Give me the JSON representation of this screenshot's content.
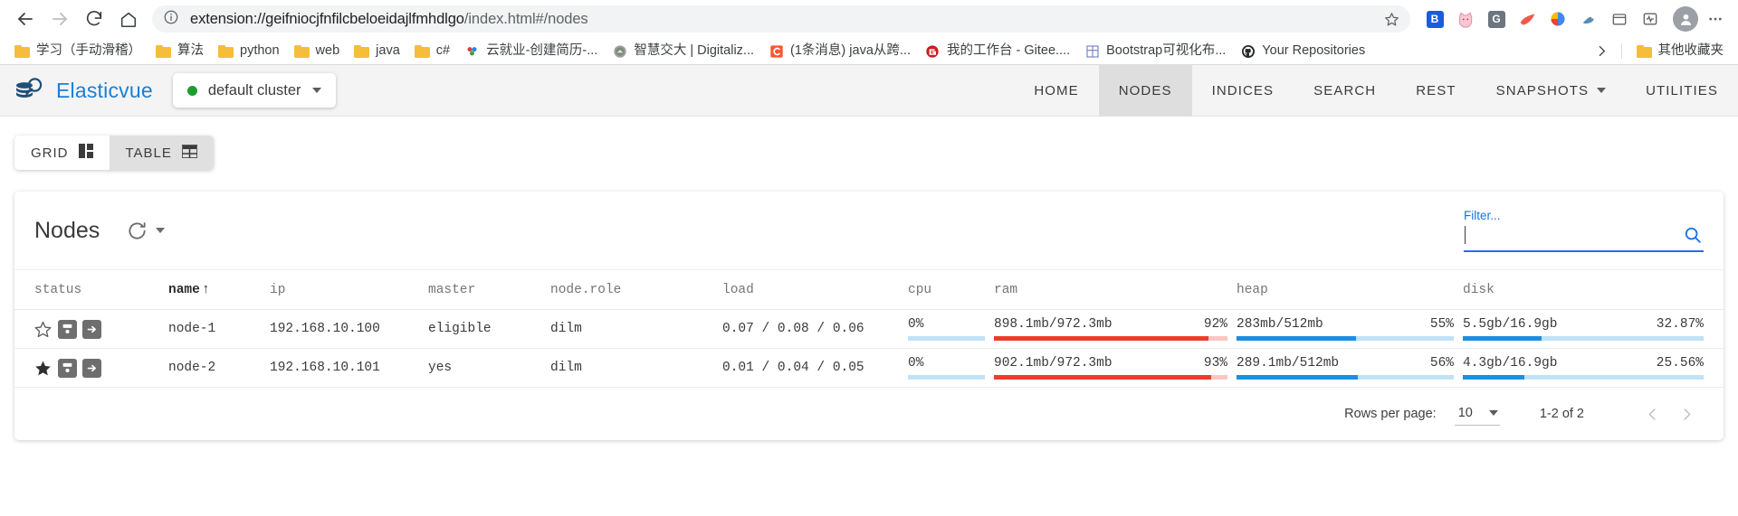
{
  "browser": {
    "back_icon": "back-arrow-icon",
    "forward_icon": "forward-arrow-icon",
    "reload_icon": "reload-icon",
    "home_icon": "home-icon",
    "url_prefix": "extension://geifniocjfnfilcbeloeidajlfmhdlgo",
    "url_suffix": "/index.html#/nodes",
    "url_full": "extension://geifniocjfnfilcbeloeidajlfmhdlgo/index.html#/nodes",
    "bookmark_star_icon": "star-outline-icon",
    "profile_icon": "profile-avatar-icon",
    "menu_icon": "three-dots-menu-icon",
    "extensions": [
      {
        "name": "extension-bitwarden",
        "glyph": "B",
        "color": "#175ddc"
      },
      {
        "name": "extension-pink-cat",
        "glyph": "",
        "color": "#f8bbd0"
      },
      {
        "name": "extension-grammarly",
        "glyph": "G",
        "color": "#15c39a"
      },
      {
        "name": "extension-orange-swoosh",
        "glyph": "",
        "color": "#f25c54"
      },
      {
        "name": "extension-colorful-globe",
        "glyph": "",
        "color": "#4285f4"
      },
      {
        "name": "extension-blue-bird",
        "glyph": "",
        "color": "#4a7fb5"
      },
      {
        "name": "extension-collections",
        "glyph": "",
        "color": "#5f6368"
      },
      {
        "name": "extension-browser-essentials",
        "glyph": "",
        "color": "#5f6368"
      }
    ],
    "bookmarks": [
      {
        "label": "学习（手动滑稽）",
        "icon": "folder-icon",
        "type": "folder"
      },
      {
        "label": "算法",
        "icon": "folder-icon",
        "type": "folder"
      },
      {
        "label": "python",
        "icon": "folder-icon",
        "type": "folder"
      },
      {
        "label": "web",
        "icon": "folder-icon",
        "type": "folder"
      },
      {
        "label": "java",
        "icon": "folder-icon",
        "type": "folder"
      },
      {
        "label": "c#",
        "icon": "folder-icon",
        "type": "folder"
      },
      {
        "label": "云就业-创建简历-...",
        "icon": "dots-colorful-icon",
        "type": "link"
      },
      {
        "label": "智慧交大 | Digitaliz...",
        "icon": "jiaoda-seal-icon",
        "type": "link"
      },
      {
        "label": "(1条消息) java从跨...",
        "icon": "csdn-icon",
        "type": "link"
      },
      {
        "label": "我的工作台 - Gitee....",
        "icon": "gitee-icon",
        "type": "link"
      },
      {
        "label": "Bootstrap可视化布...",
        "icon": "bootstrap-grid-icon",
        "type": "link"
      },
      {
        "label": "Your Repositories",
        "icon": "github-icon",
        "type": "link"
      }
    ],
    "bookmarks_overflow_icon": "chevron-right-icon",
    "other_bookmarks": {
      "label": "其他收藏夹",
      "icon": "folder-icon"
    }
  },
  "app": {
    "brand": "Elasticvue",
    "logo_icon": "elasticvue-logo-icon",
    "cluster": {
      "name": "default cluster",
      "status_color": "#1f9c31",
      "status_icon": "green-dot-icon",
      "caret_icon": "caret-down-icon"
    },
    "nav": [
      {
        "label": "HOME",
        "name": "nav-home",
        "active": false,
        "caret": false
      },
      {
        "label": "NODES",
        "name": "nav-nodes",
        "active": true,
        "caret": false
      },
      {
        "label": "INDICES",
        "name": "nav-indices",
        "active": false,
        "caret": false
      },
      {
        "label": "SEARCH",
        "name": "nav-search",
        "active": false,
        "caret": false
      },
      {
        "label": "REST",
        "name": "nav-rest",
        "active": false,
        "caret": false
      },
      {
        "label": "SNAPSHOTS",
        "name": "nav-snapshots",
        "active": false,
        "caret": true
      },
      {
        "label": "UTILITIES",
        "name": "nav-utilities",
        "active": false,
        "caret": false
      }
    ],
    "view_toggle": [
      {
        "label": "GRID",
        "icon": "grid-view-icon",
        "active": false
      },
      {
        "label": "TABLE",
        "icon": "table-view-icon",
        "active": true
      }
    ],
    "card": {
      "title": "Nodes",
      "refresh_icon": "refresh-icon",
      "refresh_caret_icon": "caret-down-icon",
      "filter": {
        "label": "Filter...",
        "value": "",
        "placeholder": "",
        "search_icon": "magnifier-icon",
        "accent": "#1a73e8"
      }
    },
    "table": {
      "columns": [
        {
          "key": "status",
          "label": "status",
          "sorted": false
        },
        {
          "key": "name",
          "label": "name",
          "sorted": true,
          "sort_icon": "↑"
        },
        {
          "key": "ip",
          "label": "ip",
          "sorted": false
        },
        {
          "key": "master",
          "label": "master",
          "sorted": false
        },
        {
          "key": "node_role",
          "label": "node.role",
          "sorted": false
        },
        {
          "key": "load",
          "label": "load",
          "sorted": false
        },
        {
          "key": "cpu",
          "label": "cpu",
          "sorted": false
        },
        {
          "key": "ram",
          "label": "ram",
          "sorted": false
        },
        {
          "key": "heap",
          "label": "heap",
          "sorted": false
        },
        {
          "key": "disk",
          "label": "disk",
          "sorted": false
        }
      ],
      "rows": [
        {
          "star_icon": "star-outline-icon",
          "star_filled": false,
          "action_icons": [
            "database-icon",
            "arrow-right-box-icon"
          ],
          "name": "node-1",
          "ip": "192.168.10.100",
          "master": "eligible",
          "node_role": "dilm",
          "load": "0.07 / 0.08 / 0.06",
          "cpu_pct_text": "0%",
          "cpu_pct": 0,
          "cpu_color": "#1a8fe3",
          "cpu_track": "#bfe2f7",
          "ram_text": "898.1mb/972.3mb",
          "ram_pct_text": "92%",
          "ram_pct": 92,
          "ram_color": "#ef3b2c",
          "ram_track": "#fbc6c1",
          "heap_text": "283mb/512mb",
          "heap_pct_text": "55%",
          "heap_pct": 55,
          "heap_color": "#1a8fe3",
          "heap_track": "#bfe2f7",
          "disk_text": "5.5gb/16.9gb",
          "disk_pct_text": "32.87%",
          "disk_pct": 32.87,
          "disk_color": "#1a8fe3",
          "disk_track": "#bfe2f7"
        },
        {
          "star_icon": "star-filled-icon",
          "star_filled": true,
          "action_icons": [
            "database-icon",
            "arrow-right-box-icon"
          ],
          "name": "node-2",
          "ip": "192.168.10.101",
          "master": "yes",
          "node_role": "dilm",
          "load": "0.01 / 0.04 / 0.05",
          "cpu_pct_text": "0%",
          "cpu_pct": 0,
          "cpu_color": "#1a8fe3",
          "cpu_track": "#bfe2f7",
          "ram_text": "902.1mb/972.3mb",
          "ram_pct_text": "93%",
          "ram_pct": 93,
          "ram_color": "#ef3b2c",
          "ram_track": "#fbc6c1",
          "heap_text": "289.1mb/512mb",
          "heap_pct_text": "56%",
          "heap_pct": 56,
          "heap_color": "#1a8fe3",
          "heap_track": "#bfe2f7",
          "disk_text": "4.3gb/16.9gb",
          "disk_pct_text": "25.56%",
          "disk_pct": 25.56,
          "disk_color": "#1a8fe3",
          "disk_track": "#bfe2f7"
        }
      ]
    },
    "pagination": {
      "rows_per_page_label": "Rows per page:",
      "rows_per_page_value": "10",
      "rows_per_page_caret_icon": "caret-down-icon",
      "range_text": "1-2 of 2",
      "prev_icon": "chevron-left-icon",
      "next_icon": "chevron-right-icon"
    }
  }
}
